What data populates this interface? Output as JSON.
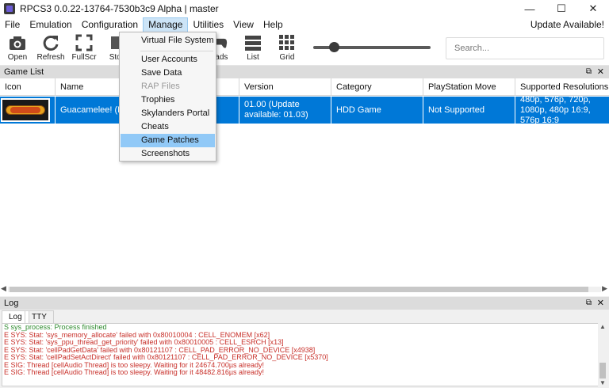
{
  "window": {
    "title": "RPCS3 0.0.22-13764-7530b3c9 Alpha | master"
  },
  "menubar": {
    "items": [
      "File",
      "Emulation",
      "Configuration",
      "Manage",
      "Utilities",
      "View",
      "Help"
    ],
    "update_label": "Update Available!"
  },
  "toolbar": {
    "open": "Open",
    "refresh": "Refresh",
    "fullscreen": "FullScr",
    "stop": "Stop",
    "pads": "Pads",
    "list": "List",
    "grid": "Grid"
  },
  "search": {
    "placeholder": "Search..."
  },
  "gamelist": {
    "panel_title": "Game List",
    "headers": [
      "Icon",
      "Name",
      "Version",
      "Category",
      "PlayStation Move",
      "Supported Resolutions"
    ],
    "row": {
      "icon_alt": "Guacamelee!",
      "name": "Guacamelee! (PlayStation Demo)",
      "version": "01.00 (Update available: 01.03)",
      "category": "HDD Game",
      "move": "Not Supported",
      "resolutions": "480p, 576p, 720p, 1080p, 480p 16:9, 576p 16:9"
    }
  },
  "manage_menu": {
    "items": [
      "Virtual File System",
      "User Accounts",
      "Save Data",
      "RAP Files",
      "Trophies",
      "Skylanders Portal",
      "Cheats",
      "Game Patches",
      "Screenshots"
    ]
  },
  "log": {
    "panel_title": "Log",
    "tabs": [
      "Log",
      "TTY"
    ],
    "lines": [
      "S sys_process: Process finished",
      "E SYS: Stat: 'sys_memory_allocate' failed with 0x80010004 : CELL_ENOMEM [x62]",
      "E SYS: Stat: 'sys_ppu_thread_get_priority' failed with 0x80010005 : CELL_ESRCH [x13]",
      "E SYS: Stat: 'cellPadGetData' failed with 0x80121107 : CELL_PAD_ERROR_NO_DEVICE [x4938]",
      "E SYS: Stat: 'cellPadSetActDirect' failed with 0x80121107 : CELL_PAD_ERROR_NO_DEVICE [x5370]",
      "E SIG: Thread [cellAudio Thread] is too sleepy. Waiting for it 24674.700µs already!",
      "E SIG: Thread [cellAudio Thread] is too sleepy. Waiting for it 48482.816µs already!"
    ]
  },
  "colors": {
    "selection": "#0078d7",
    "menu_highlight": "#91c9f7",
    "log_success": "#2e8b2e",
    "log_error": "#c8302a"
  }
}
